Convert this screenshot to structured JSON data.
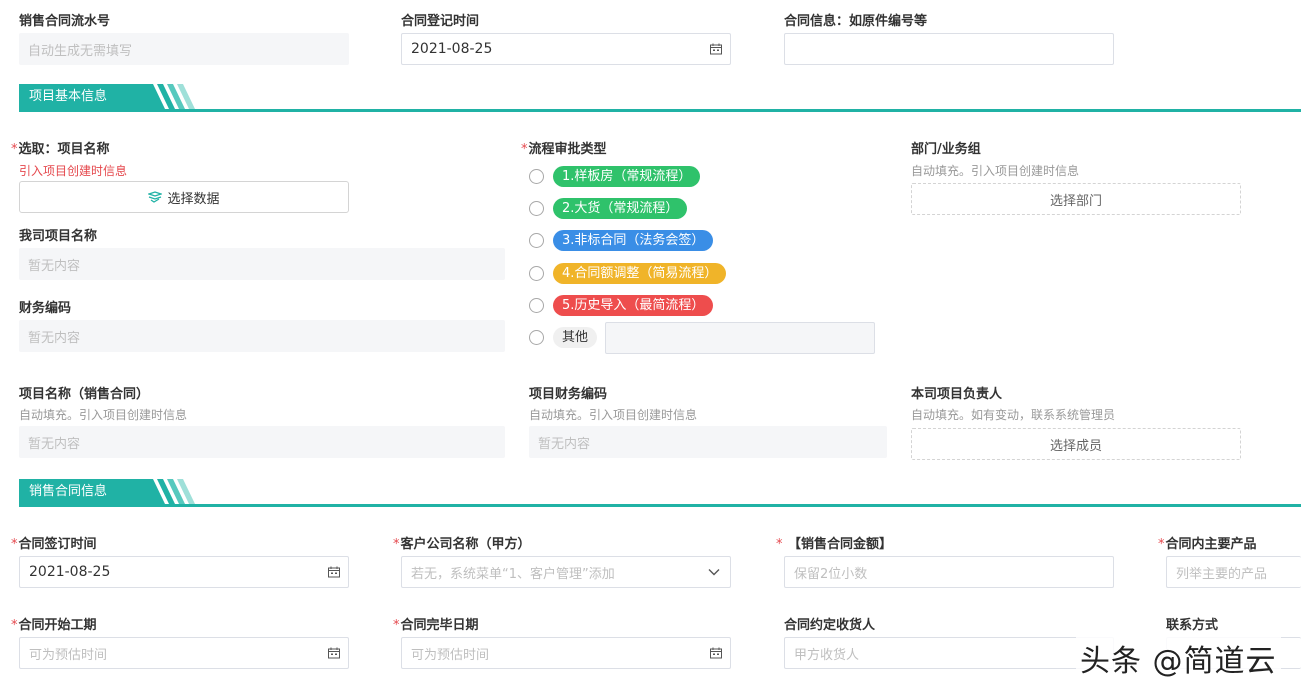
{
  "top": {
    "serial": {
      "label": "销售合同流水号",
      "placeholder": "自动生成无需填写"
    },
    "reg_time": {
      "label": "合同登记时间",
      "value": "2021-08-25"
    },
    "contract_info": {
      "label": "合同信息：如原件编号等",
      "value": ""
    }
  },
  "sections": {
    "basic": {
      "title": "项目基本信息"
    },
    "sales": {
      "title": "销售合同信息"
    }
  },
  "basic": {
    "project_select": {
      "required": "*",
      "label": "选取：项目名称",
      "hint": "引入项目创建时信息",
      "button": "选择数据"
    },
    "our_project_name": {
      "label": "我司项目名称",
      "placeholder": "暂无内容"
    },
    "finance_code": {
      "label": "财务编码",
      "placeholder": "暂无内容"
    },
    "flow_type": {
      "required": "*",
      "label": "流程审批类型",
      "options": [
        {
          "label": "1.样板房（常规流程）",
          "color": "#2fc26b"
        },
        {
          "label": "2.大货（常规流程）",
          "color": "#2fc26b"
        },
        {
          "label": "3.非标合同（法务会签）",
          "color": "#3a8ee6"
        },
        {
          "label": "4.合同额调整（简易流程）",
          "color": "#f0b429"
        },
        {
          "label": "5.历史导入（最简流程）",
          "color": "#ee4d4d"
        },
        {
          "label": "其他",
          "color": "#f0f0f0"
        }
      ],
      "other_value": ""
    },
    "dept": {
      "label": "部门/业务组",
      "hint": "自动填充。引入项目创建时信息",
      "button": "选择部门"
    },
    "project_name_sales": {
      "label": "项目名称（销售合同）",
      "hint": "自动填充。引入项目创建时信息",
      "placeholder": "暂无内容"
    },
    "project_finance_code": {
      "label": "项目财务编码",
      "hint": "自动填充。引入项目创建时信息",
      "placeholder": "暂无内容"
    },
    "owner": {
      "label": "本司项目负责人",
      "hint": "自动填充。如有变动，联系系统管理员",
      "button": "选择成员"
    }
  },
  "sales": {
    "sign_date": {
      "required": "*",
      "label": "合同签订时间",
      "value": "2021-08-25"
    },
    "customer": {
      "required": "*",
      "label": "客户公司名称（甲方）",
      "placeholder": "若无，系统菜单“1、客户管理”添加"
    },
    "amount": {
      "required": "*",
      "label": "【销售合同金额】",
      "placeholder": "保留2位小数"
    },
    "products": {
      "required": "*",
      "label": "合同内主要产品",
      "placeholder": "列举主要的产品"
    },
    "start_date": {
      "required": "*",
      "label": "合同开始工期",
      "placeholder": "可为预估时间"
    },
    "end_date": {
      "required": "*",
      "label": "合同完毕日期",
      "placeholder": "可为预估时间"
    },
    "receiver": {
      "label": "合同约定收货人",
      "placeholder": "甲方收货人"
    },
    "contact": {
      "label": "联系方式"
    }
  },
  "watermark": "头条 @简道云",
  "icons": {
    "calendar": "calendar-icon",
    "chevron": "chevron-down-icon",
    "select": "select-data-icon"
  }
}
